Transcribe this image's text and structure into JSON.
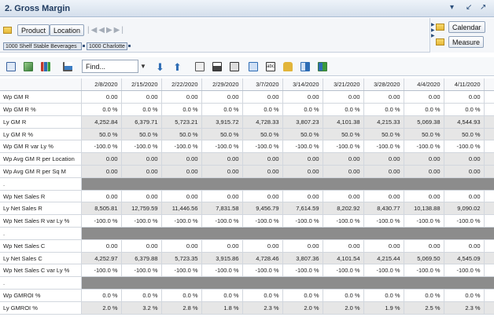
{
  "window": {
    "title": "2. Gross Margin"
  },
  "dimensions": {
    "row_buttons": [
      "Product",
      "Location"
    ],
    "crumbs": [
      "1000 Shelf Stable Beverages",
      "1000 Charlotte"
    ],
    "side_buttons": [
      "Calendar",
      "Measure"
    ]
  },
  "toolbar": {
    "find_placeholder": "Find..."
  },
  "grid": {
    "columns": [
      "2/8/2020",
      "2/15/2020",
      "2/22/2020",
      "2/29/2020",
      "3/7/2020",
      "3/14/2020",
      "3/21/2020",
      "3/28/2020",
      "4/4/2020",
      "4/11/2020"
    ],
    "rows": [
      {
        "type": "white",
        "label": "Wp GM R",
        "values": [
          "0.00",
          "0.00",
          "0.00",
          "0.00",
          "0.00",
          "0.00",
          "0.00",
          "0.00",
          "0.00",
          "0.00"
        ]
      },
      {
        "type": "white",
        "label": "Wp GM R %",
        "values": [
          "0.0 %",
          "0.0 %",
          "0.0 %",
          "0.0 %",
          "0.0 %",
          "0.0 %",
          "0.0 %",
          "0.0 %",
          "0.0 %",
          "0.0 %"
        ]
      },
      {
        "type": "grey",
        "label": "Ly GM R",
        "values": [
          "4,252.84",
          "6,379.71",
          "5,723.21",
          "3,915.72",
          "4,728.33",
          "3,807.23",
          "4,101.38",
          "4,215.33",
          "5,069.38",
          "4,544.93"
        ]
      },
      {
        "type": "grey",
        "label": "Ly GM R %",
        "values": [
          "50.0 %",
          "50.0 %",
          "50.0 %",
          "50.0 %",
          "50.0 %",
          "50.0 %",
          "50.0 %",
          "50.0 %",
          "50.0 %",
          "50.0 %"
        ]
      },
      {
        "type": "white",
        "label": "Wp GM R var Ly %",
        "values": [
          "-100.0 %",
          "-100.0 %",
          "-100.0 %",
          "-100.0 %",
          "-100.0 %",
          "-100.0 %",
          "-100.0 %",
          "-100.0 %",
          "-100.0 %",
          "-100.0 %"
        ]
      },
      {
        "type": "grey",
        "label": "Wp Avg GM R per Location",
        "values": [
          "0.00",
          "0.00",
          "0.00",
          "0.00",
          "0.00",
          "0.00",
          "0.00",
          "0.00",
          "0.00",
          "0.00"
        ]
      },
      {
        "type": "grey",
        "label": "Wp Avg GM R per Sq M",
        "values": [
          "0.00",
          "0.00",
          "0.00",
          "0.00",
          "0.00",
          "0.00",
          "0.00",
          "0.00",
          "0.00",
          "0.00"
        ]
      },
      {
        "type": "sep",
        "label": ".",
        "values": [
          "",
          "",
          "",
          "",
          "",
          "",
          "",
          "",
          "",
          ""
        ]
      },
      {
        "type": "white",
        "label": "Wp Net Sales R",
        "values": [
          "0.00",
          "0.00",
          "0.00",
          "0.00",
          "0.00",
          "0.00",
          "0.00",
          "0.00",
          "0.00",
          "0.00"
        ]
      },
      {
        "type": "grey",
        "label": "Ly Net Sales R",
        "values": [
          "8,505.81",
          "12,759.59",
          "11,446.56",
          "7,831.58",
          "9,456.79",
          "7,614.59",
          "8,202.92",
          "8,430.77",
          "10,138.88",
          "9,090.02"
        ]
      },
      {
        "type": "white",
        "label": "Wp Net Sales R var Ly %",
        "values": [
          "-100.0 %",
          "-100.0 %",
          "-100.0 %",
          "-100.0 %",
          "-100.0 %",
          "-100.0 %",
          "-100.0 %",
          "-100.0 %",
          "-100.0 %",
          "-100.0 %"
        ]
      },
      {
        "type": "sep",
        "label": ".",
        "values": [
          "",
          "",
          "",
          "",
          "",
          "",
          "",
          "",
          "",
          ""
        ]
      },
      {
        "type": "white",
        "label": "Wp Net Sales C",
        "values": [
          "0.00",
          "0.00",
          "0.00",
          "0.00",
          "0.00",
          "0.00",
          "0.00",
          "0.00",
          "0.00",
          "0.00"
        ]
      },
      {
        "type": "grey",
        "label": "Ly Net Sales C",
        "values": [
          "4,252.97",
          "6,379.88",
          "5,723.35",
          "3,915.86",
          "4,728.46",
          "3,807.36",
          "4,101.54",
          "4,215.44",
          "5,069.50",
          "4,545.09"
        ]
      },
      {
        "type": "white",
        "label": "Wp Net Sales C var Ly %",
        "values": [
          "-100.0 %",
          "-100.0 %",
          "-100.0 %",
          "-100.0 %",
          "-100.0 %",
          "-100.0 %",
          "-100.0 %",
          "-100.0 %",
          "-100.0 %",
          "-100.0 %"
        ]
      },
      {
        "type": "sep",
        "label": ".",
        "values": [
          "",
          "",
          "",
          "",
          "",
          "",
          "",
          "",
          "",
          ""
        ]
      },
      {
        "type": "white",
        "label": "Wp GMROI %",
        "values": [
          "0.0 %",
          "0.0 %",
          "0.0 %",
          "0.0 %",
          "0.0 %",
          "0.0 %",
          "0.0 %",
          "0.0 %",
          "0.0 %",
          "0.0 %"
        ]
      },
      {
        "type": "grey",
        "label": "Ly GMROI %",
        "values": [
          "2.0 %",
          "3.2 %",
          "2.8 %",
          "1.8 %",
          "2.3 %",
          "2.0 %",
          "2.0 %",
          "1.9 %",
          "2.5 %",
          "2.3 %"
        ]
      }
    ]
  },
  "colors": {
    "title_text": "#1f3b60",
    "grey_cell": "#e6e6e6",
    "separator": "#8c8c8c"
  }
}
